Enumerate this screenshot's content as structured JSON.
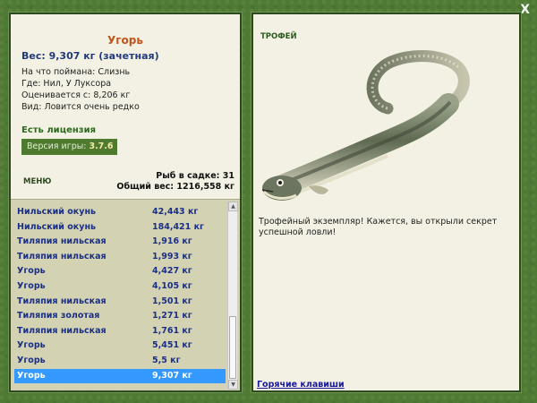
{
  "window": {
    "close_label": "X"
  },
  "catch": {
    "name": "Угорь",
    "weight_line": "Вес: 9,307 кг (зачетная)",
    "bait": "На что поймана: Слизнь",
    "location": "Где: Нил, У Луксора",
    "value": "Оценивается с: 8,206 кг",
    "rarity": "Вид: Ловится очень редко"
  },
  "license": "Есть лицензия",
  "version": {
    "label": "Версия игры:",
    "value": "3.7.6"
  },
  "menu_label": "МЕНЮ",
  "stats": {
    "fish_count": "Рыб в садке: 31",
    "total_weight": "Общий вес: 1216,558 кг"
  },
  "catch_list": [
    {
      "name": "Нильский окунь",
      "weight": "42,443 кг"
    },
    {
      "name": "Нильский окунь",
      "weight": "184,421 кг"
    },
    {
      "name": "Тиляпия нильская",
      "weight": "1,916 кг"
    },
    {
      "name": "Тиляпия нильская",
      "weight": "1,993 кг"
    },
    {
      "name": "Угорь",
      "weight": "4,427 кг"
    },
    {
      "name": "Угорь",
      "weight": "4,105 кг"
    },
    {
      "name": "Тиляпия нильская",
      "weight": "1,501 кг"
    },
    {
      "name": "Тиляпия золотая",
      "weight": "1,271 кг"
    },
    {
      "name": "Тиляпия нильская",
      "weight": "1,761 кг"
    },
    {
      "name": "Угорь",
      "weight": "5,451 кг"
    },
    {
      "name": "Угорь",
      "weight": "5,5 кг"
    },
    {
      "name": "Угорь",
      "weight": "9,307 кг",
      "selected": true
    }
  ],
  "trophy": {
    "label": "ТРОФЕЙ",
    "text": "Трофейный экземпляр! Кажется, вы открыли секрет успешной ловли!",
    "image": "eel-illustration"
  },
  "hotkeys_label": "Горячие клавиши",
  "colors": {
    "frame_green": "#4f7a34",
    "panel_bg": "#f2f1e3",
    "title_orange": "#c0561d",
    "list_text_blue": "#1b2f86",
    "selection_blue": "#3399ff"
  }
}
